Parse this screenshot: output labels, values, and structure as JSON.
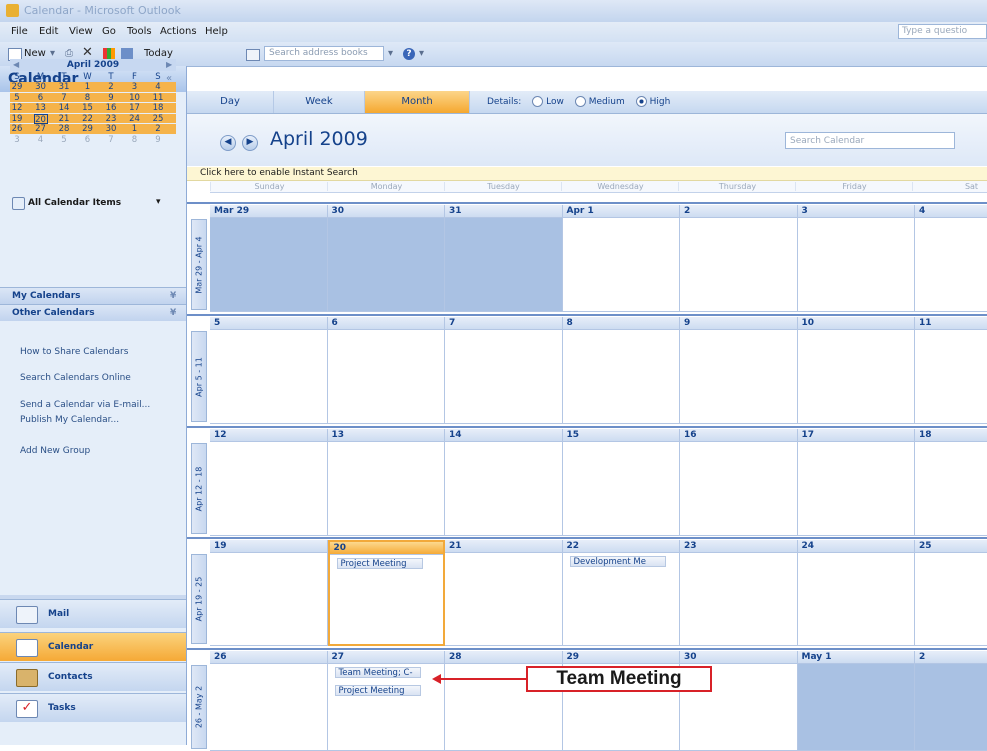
{
  "window": {
    "title": "Calendar - Microsoft Outlook"
  },
  "menu": {
    "items": [
      "File",
      "Edit",
      "View",
      "Go",
      "Tools",
      "Actions",
      "Help"
    ],
    "help_placeholder": "Type a questio"
  },
  "toolbar": {
    "new_label": "New",
    "today_label": "Today",
    "address_placeholder": "Search address books"
  },
  "nav": {
    "title": "Calendar",
    "mini_calendar": {
      "month": "April 2009",
      "dow": [
        "S",
        "M",
        "T",
        "W",
        "T",
        "F",
        "S"
      ],
      "weeks": [
        [
          "29",
          "30",
          "31",
          "1",
          "2",
          "3",
          "4"
        ],
        [
          "5",
          "6",
          "7",
          "8",
          "9",
          "10",
          "11"
        ],
        [
          "12",
          "13",
          "14",
          "15",
          "16",
          "17",
          "18"
        ],
        [
          "19",
          "20",
          "21",
          "22",
          "23",
          "24",
          "25"
        ],
        [
          "26",
          "27",
          "28",
          "29",
          "30",
          "1",
          "2"
        ],
        [
          "3",
          "4",
          "5",
          "6",
          "7",
          "8",
          "9"
        ]
      ]
    },
    "all_items_label": "All Calendar Items",
    "my_calendars": "My Calendars",
    "other_calendars": "Other Calendars",
    "links": [
      "How to Share Calendars",
      "Search Calendars Online",
      "Send a Calendar via E-mail...",
      "Publish My Calendar...",
      "Add New Group"
    ],
    "buttons": [
      "Mail",
      "Calendar",
      "Contacts",
      "Tasks"
    ]
  },
  "view": {
    "tabs": [
      "Day",
      "Week",
      "Month"
    ],
    "active_tab": "Month",
    "details_label": "Details:",
    "details_options": [
      "Low",
      "Medium",
      "High"
    ],
    "details_selected": "High"
  },
  "calendar": {
    "title": "April 2009",
    "search_placeholder": "Search Calendar",
    "instant_search": "Click here to enable Instant Search",
    "dow": [
      "Sunday",
      "Monday",
      "Tuesday",
      "Wednesday",
      "Thursday",
      "Friday",
      "Sat"
    ],
    "week_labels": [
      "Mar 29 - Apr 4",
      "Apr 5 - 11",
      "Apr 12 - 18",
      "Apr 19 - 25",
      "26 - May 2"
    ],
    "weeks": [
      [
        "Mar 29",
        "30",
        "31",
        "Apr 1",
        "2",
        "3",
        "4"
      ],
      [
        "5",
        "6",
        "7",
        "8",
        "9",
        "10",
        "11"
      ],
      [
        "12",
        "13",
        "14",
        "15",
        "16",
        "17",
        "18"
      ],
      [
        "19",
        "20",
        "21",
        "22",
        "23",
        "24",
        "25"
      ],
      [
        "26",
        "27",
        "28",
        "29",
        "30",
        "May 1",
        "2"
      ]
    ],
    "appointments": {
      "apr20": "Project Meeting",
      "apr22": "Development Me",
      "apr27_a": "Team Meeting; C-",
      "apr27_b": "Project Meeting"
    }
  },
  "callout": {
    "label": "Team Meeting"
  },
  "colors": {
    "accent": "#f5a936",
    "brand": "#15428b",
    "callout": "#d82128"
  }
}
